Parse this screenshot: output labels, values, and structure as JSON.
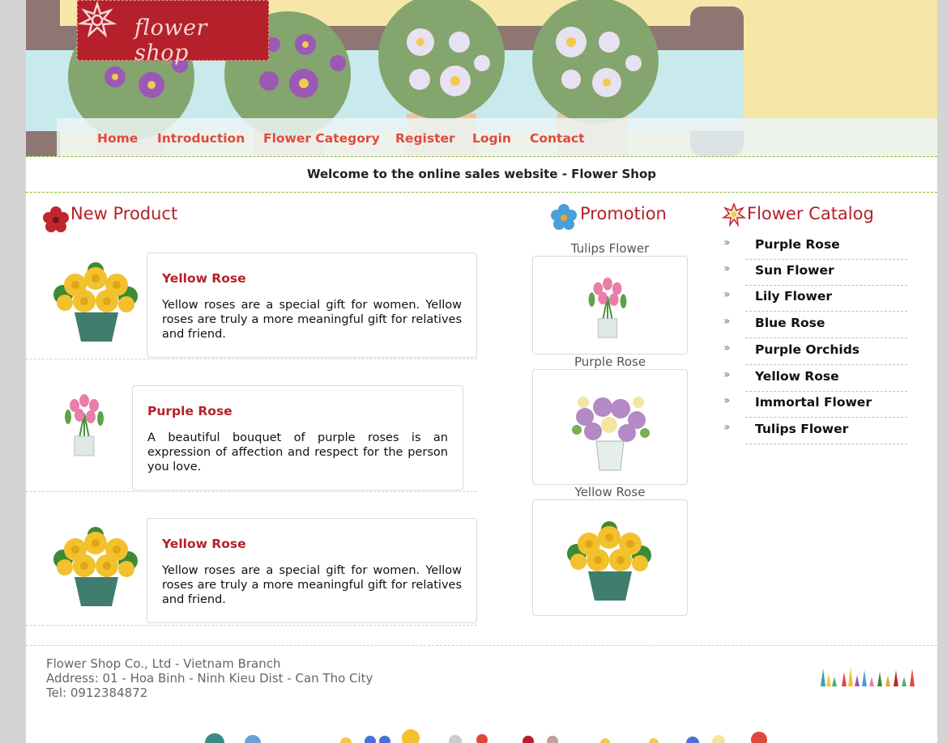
{
  "brand": {
    "logo_text": "flower shop"
  },
  "nav": [
    "Home",
    "Introduction",
    "Flower Category",
    "Register",
    "Login",
    "Contact"
  ],
  "welcome": "Welcome to the online sales website - Flower Shop",
  "new_product": {
    "title": "New Product",
    "items": [
      {
        "name": "Yellow Rose",
        "desc": "Yellow roses are a special gift for women. Yellow roses are truly a more meaningful gift for relatives and friend."
      },
      {
        "name": "Purple Rose",
        "desc": "A beautiful bouquet of purple roses is an expression of affection and respect for the person you love."
      },
      {
        "name": "Yellow Rose",
        "desc": "Yellow roses are a special gift for women. Yellow roses are truly a more meaningful gift for relatives and friend."
      }
    ]
  },
  "promotion": {
    "title": "Promotion",
    "items": [
      {
        "label": "Tulips Flower"
      },
      {
        "label": "Purple Rose"
      },
      {
        "label": "Yellow Rose"
      }
    ]
  },
  "catalog": {
    "title": "Flower Catalog",
    "items": [
      "Purple Rose",
      "Sun Flower",
      "Lily Flower",
      "Blue Rose",
      "Purple Orchids",
      "Yellow Rose",
      "Immortal Flower",
      "Tulips Flower"
    ]
  },
  "footer": {
    "company": "Flower Shop Co., Ltd - Vietnam Branch",
    "address": "Address: 01 - Hoa Binh - Ninh Kieu Dist - Can Tho City",
    "tel": "Tel: 0912384872"
  },
  "colors": {
    "accent": "#b5202a",
    "nav_text": "#e3473c",
    "welcome_border": "#8fb82a"
  }
}
